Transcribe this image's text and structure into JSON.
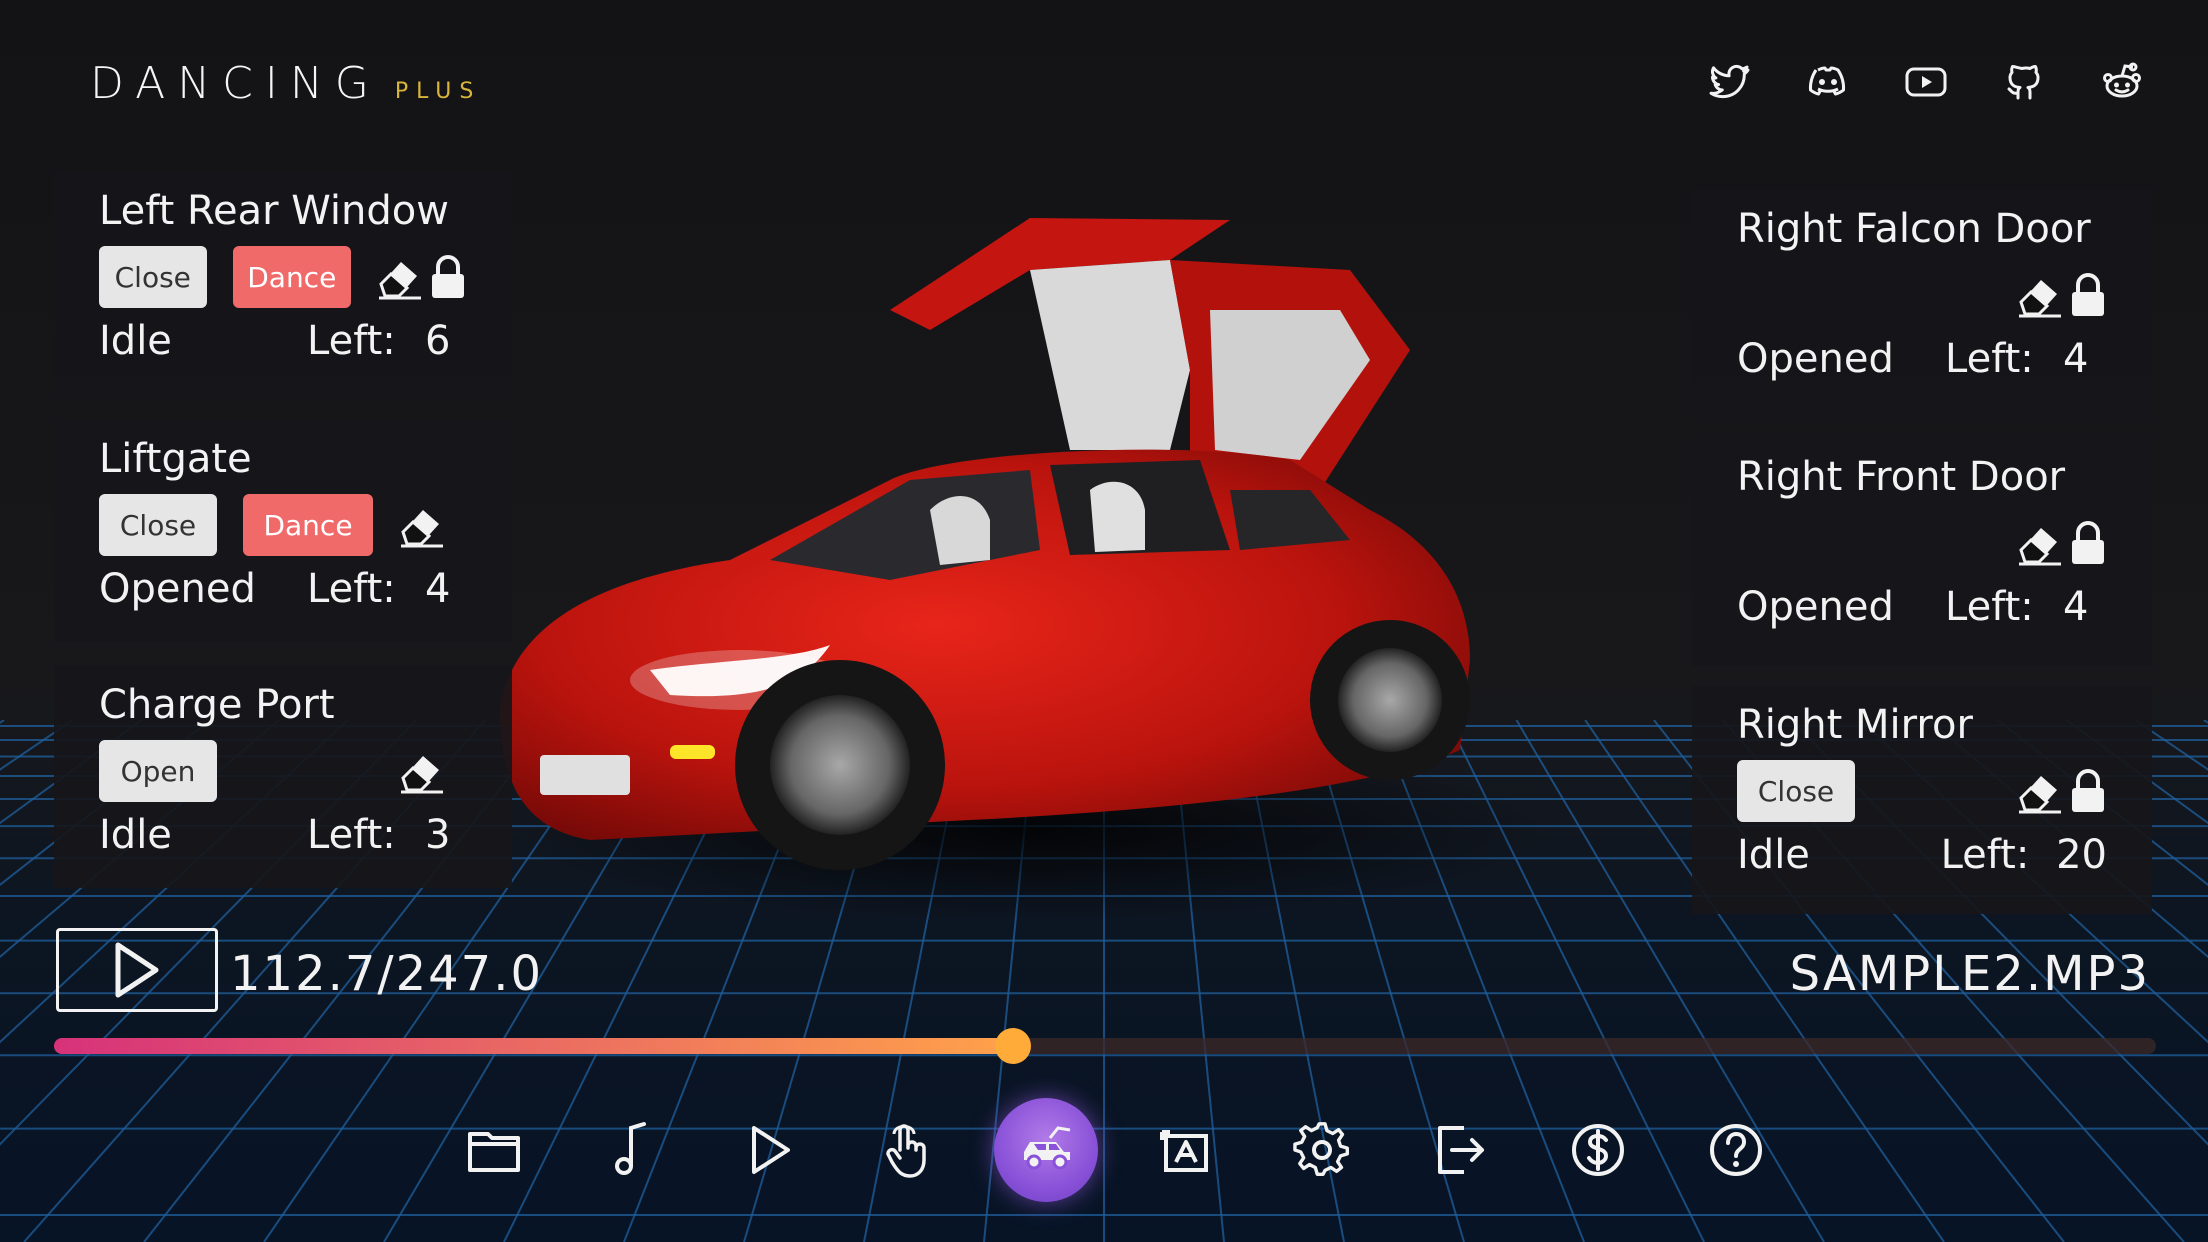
{
  "app": {
    "title_main": "DANCING",
    "title_plus": "PLUS"
  },
  "social_icons": [
    "twitter-icon",
    "discord-icon",
    "youtube-icon",
    "github-icon",
    "reddit-icon"
  ],
  "left_panels": [
    {
      "title": "Left Rear Window",
      "btn_primary": "Close",
      "btn_dance": "Dance",
      "has_lock": true,
      "status": "Idle",
      "left_label": "Left:",
      "left_value": "6"
    },
    {
      "title": "Liftgate",
      "btn_primary": "Close",
      "btn_dance": "Dance",
      "has_lock": false,
      "status": "Opened",
      "left_label": "Left:",
      "left_value": "4"
    },
    {
      "title": "Charge Port",
      "btn_primary": "Open",
      "has_lock": false,
      "status": "Idle",
      "left_label": "Left:",
      "left_value": "3"
    }
  ],
  "right_panels": [
    {
      "title": "Right Falcon Door",
      "has_lock": true,
      "status": "Opened",
      "left_label": "Left:",
      "left_value": "4"
    },
    {
      "title": "Right Front Door",
      "has_lock": true,
      "status": "Opened",
      "left_label": "Left:",
      "left_value": "4"
    },
    {
      "title": "Right Mirror",
      "btn_primary": "Close",
      "has_lock": true,
      "status": "Idle",
      "left_label": "Left:",
      "left_value": "20"
    }
  ],
  "playback": {
    "time_display": "112.7/247.0",
    "file_name": "SAMPLE2.MP3",
    "progress_fraction": 0.456
  },
  "toolbar": [
    {
      "name": "folder-icon",
      "active": false
    },
    {
      "name": "music-note-icon",
      "active": false
    },
    {
      "name": "play-icon",
      "active": false
    },
    {
      "name": "touch-hand-icon",
      "active": false
    },
    {
      "name": "car-icon",
      "active": true
    },
    {
      "name": "text-recognition-icon",
      "active": false
    },
    {
      "name": "settings-icon",
      "active": false
    },
    {
      "name": "export-icon",
      "active": false
    },
    {
      "name": "donate-icon",
      "active": false
    },
    {
      "name": "help-icon",
      "active": false
    }
  ],
  "colors": {
    "accent_gold": "#d8b53a",
    "dance_button": "#f06a6a",
    "progress_start": "#d6327a",
    "progress_end": "#ffa24a",
    "active_tool": "#8a52d8",
    "grid": "#1f5f9c"
  }
}
